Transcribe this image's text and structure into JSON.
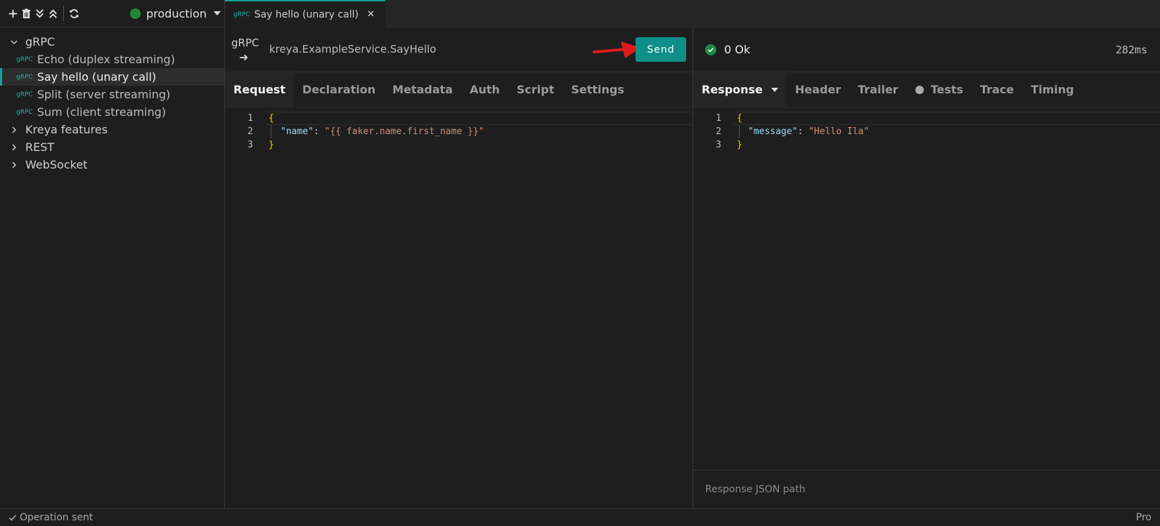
{
  "sidebar": {
    "toolbar": {
      "add_icon": "plus-icon",
      "delete_icon": "trash-icon",
      "collapse_icon": "collapse-all-icon",
      "expand_icon": "expand-all-icon",
      "refresh_icon": "refresh-icon"
    },
    "environment": {
      "name": "production",
      "status_color": "#1d8a32"
    },
    "tree": {
      "group_grpc": "gRPC",
      "ops": [
        {
          "badge": "gRPC",
          "label": "Echo (duplex streaming)"
        },
        {
          "badge": "gRPC",
          "label": "Say hello (unary call)"
        },
        {
          "badge": "gRPC",
          "label": "Split (server streaming)"
        },
        {
          "badge": "gRPC",
          "label": "Sum (client streaming)"
        }
      ],
      "folders": [
        "Kreya features",
        "REST",
        "WebSocket"
      ]
    }
  },
  "tab": {
    "badge": "gRPC",
    "title": "Say hello (unary call)",
    "close": "✕"
  },
  "request": {
    "protocol": "gRPC",
    "direction_arrow": "➜",
    "method": "kreya.ExampleService.SayHello",
    "send_label": "Send",
    "tabs": [
      "Request",
      "Declaration",
      "Metadata",
      "Auth",
      "Script",
      "Settings"
    ],
    "body": {
      "line_numbers": [
        "1",
        "2",
        "3"
      ],
      "open": "{",
      "key": "\"name\"",
      "colon": ": ",
      "value": "\"{{ faker.name.first_name }}\"",
      "close": "}"
    }
  },
  "response": {
    "status": "0 Ok",
    "duration": "282ms",
    "tabs": [
      "Response",
      "Header",
      "Trailer",
      "Tests",
      "Trace",
      "Timing"
    ],
    "body": {
      "line_numbers": [
        "1",
        "2",
        "3"
      ],
      "open": "{",
      "key": "\"message\"",
      "colon": ": ",
      "value": "\"Hello Ila\"",
      "close": "}"
    },
    "json_path_placeholder": "Response JSON path"
  },
  "statusbar": {
    "message": "Operation sent",
    "right": "Pro"
  },
  "colors": {
    "accent": "#14a39a",
    "send": "#0e8f88",
    "ok": "#1e8a44",
    "annotation_arrow": "#e01a1a"
  }
}
